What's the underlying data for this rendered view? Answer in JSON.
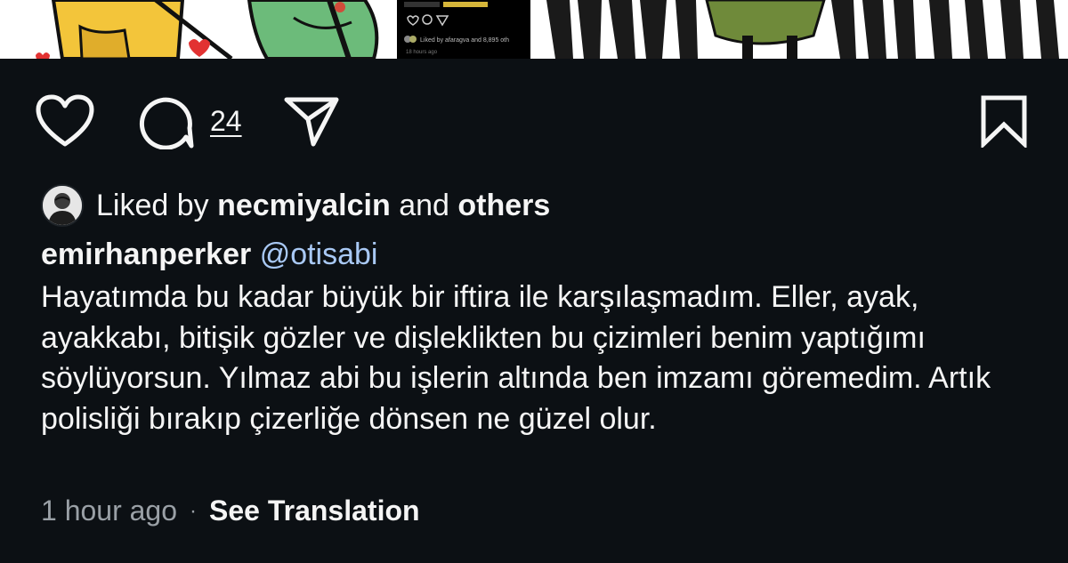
{
  "post": {
    "comment_count": "24",
    "liked_by": {
      "prefix": "Liked by",
      "user": "necmiyalcin",
      "connector": "and",
      "suffix": "others"
    },
    "caption": {
      "username": "emirhanperker",
      "mention": "@otisabi",
      "text": "Hayatımda bu kadar büyük bir iftira ile karşılaşmadım. Eller, ayak, ayakkabı, bitişik gözler ve dişleklikten bu çizimleri benim yaptığımı söylüyorsun. Yılmaz abi bu işlerin altında ben imzamı göremedim. Artık polisliği bırakıp çizerliğe dönsen ne güzel olur."
    },
    "timestamp": "1 hour ago",
    "separator": "·",
    "translate_label": "See Translation"
  },
  "media_preview": {
    "embedded_screenshot_text": "Liked by afaragva and 8,895 oth",
    "embedded_screenshot_time": "18 hours ago"
  },
  "icons": {
    "like": "heart-icon",
    "comment": "comment-icon",
    "share": "share-icon",
    "save": "bookmark-icon"
  },
  "colors": {
    "background": "#0c1014",
    "text": "#f5f5f5",
    "muted": "#9aa0a6",
    "mention": "#a9c9f5"
  }
}
